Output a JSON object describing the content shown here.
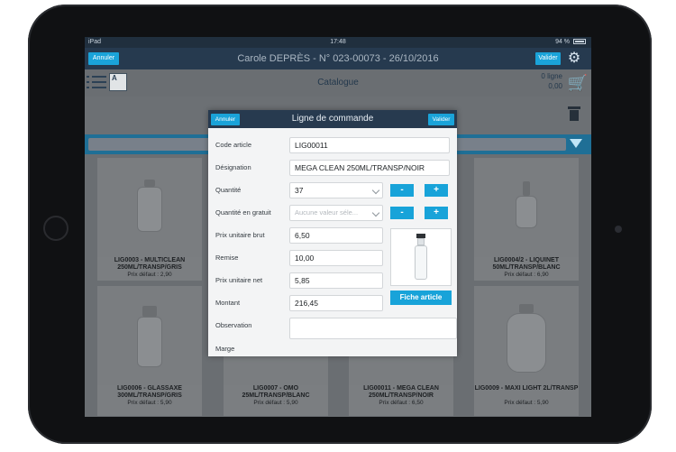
{
  "statusbar": {
    "device": "iPad",
    "time": "17:48",
    "battery": "94 %"
  },
  "header": {
    "cancel_label": "Annuler",
    "title": "Carole DEPRÈS - N° 023-00073 - 26/10/2016",
    "validate_label": "Valider"
  },
  "subbar": {
    "title": "Catalogue",
    "doc_label": "A",
    "cart_lines": "0 ligne",
    "cart_total": "0,00"
  },
  "products": [
    {
      "name": "LIG0003 - MULTICLEAN 250ML/TRANSP/GRIS",
      "price": "Prix défaut : 2,90"
    },
    {
      "name": "LIG0004/2 - LIQUINET 50ML/TRANSP/BLANC",
      "price": "Prix défaut : 6,90"
    },
    {
      "name": "LIG0006 - GLASSAXE 300ML/TRANSP/GRIS",
      "price": "Prix défaut : 5,90"
    },
    {
      "name": "LIG0007 - OMO 25ML/TRANSP/BLANC",
      "price": "Prix défaut : 5,90"
    },
    {
      "name": "LIG00011 - MEGA CLEAN 250ML/TRANSP/NOIR",
      "price": "Prix défaut : 6,50"
    },
    {
      "name": "LIG0009 - MAXI LIGHT 2L/TRANSP",
      "price": "Prix défaut : 5,90"
    }
  ],
  "modal": {
    "title": "Ligne de commande",
    "cancel_label": "Annuler",
    "validate_label": "Valider",
    "labels": {
      "code": "Code article",
      "designation": "Désignation",
      "quantite": "Quantité",
      "quantite_gratuit": "Quantité en gratuit",
      "prix_brut": "Prix unitaire brut",
      "remise": "Remise",
      "prix_net": "Prix unitaire net",
      "montant": "Montant",
      "observation": "Observation",
      "marge": "Marge"
    },
    "values": {
      "code": "LIG00011",
      "designation": "MEGA CLEAN 250ML/TRANSP/NOIR",
      "quantite": "37",
      "quantite_gratuit_placeholder": "Aucune valeur séle...",
      "prix_brut": "6,50",
      "remise": "10,00",
      "prix_net": "5,85",
      "montant": "216,45",
      "observation": ""
    },
    "minus": "-",
    "plus": "+",
    "fiche_label": "Fiche article"
  }
}
